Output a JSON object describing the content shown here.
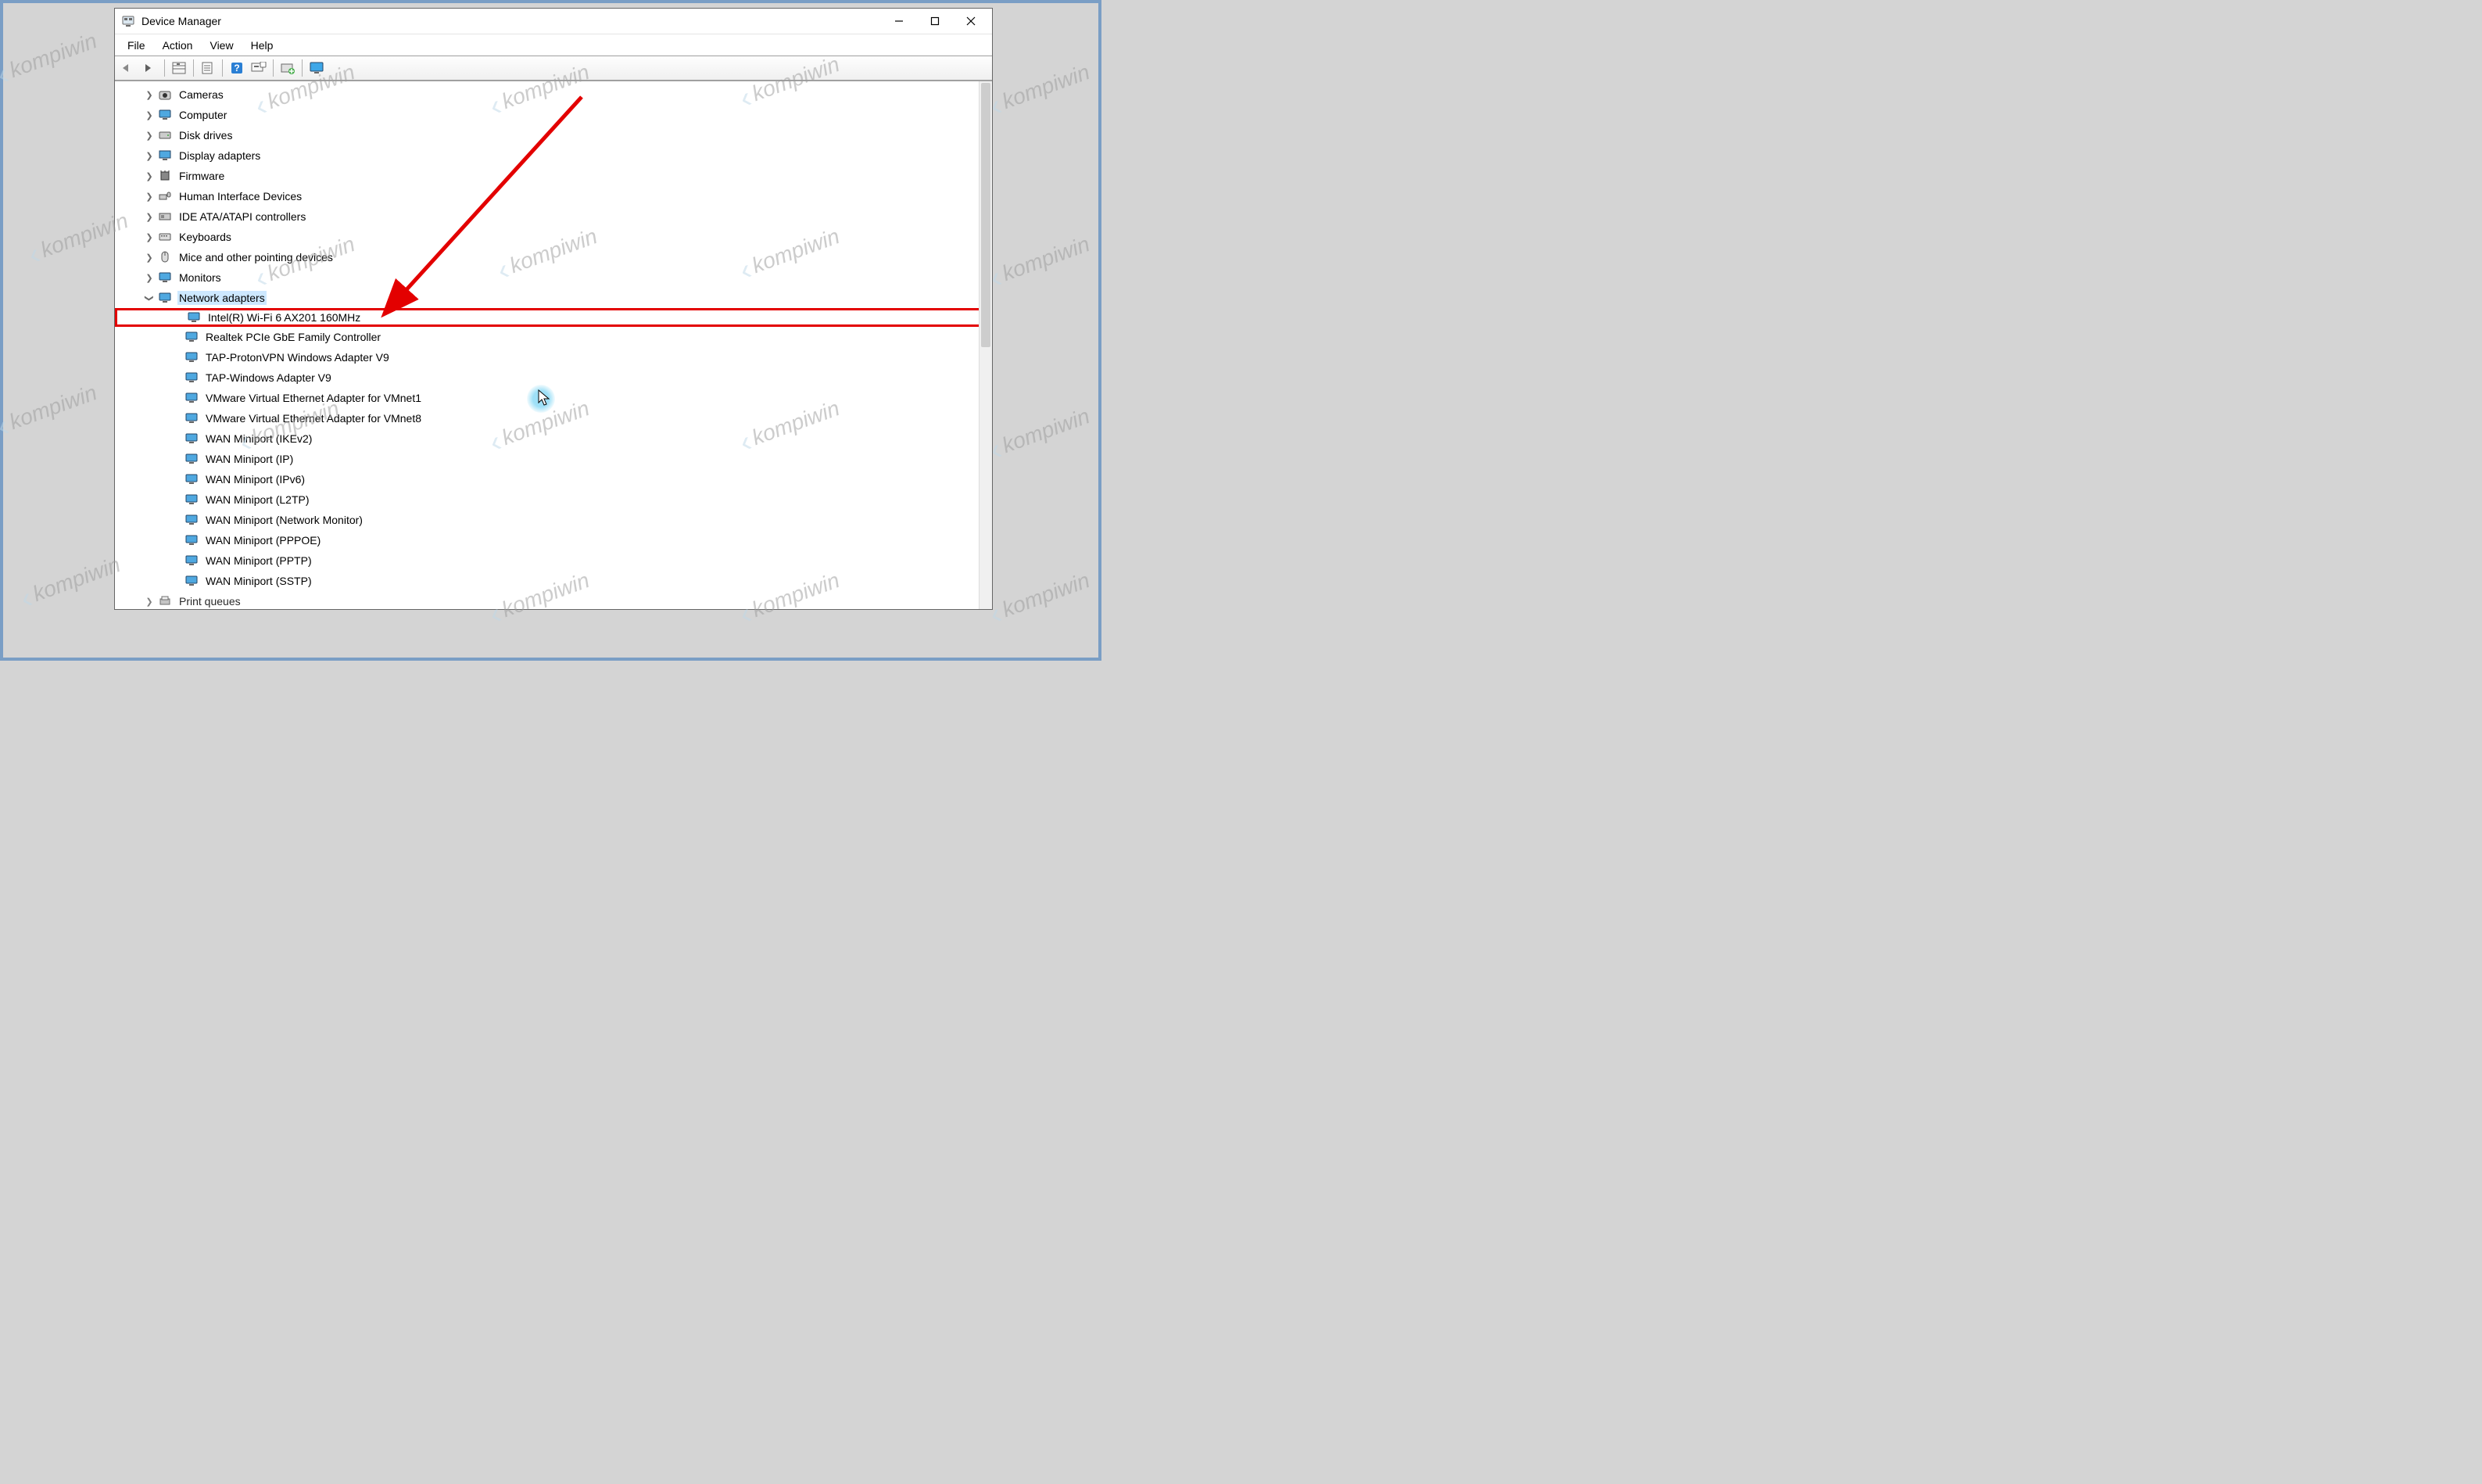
{
  "window": {
    "title": "Device Manager"
  },
  "menu": {
    "file": "File",
    "action": "Action",
    "view": "View",
    "help": "Help"
  },
  "categories": {
    "cameras": "Cameras",
    "computer": "Computer",
    "disk_drives": "Disk drives",
    "display_adapters": "Display adapters",
    "firmware": "Firmware",
    "hid": "Human Interface Devices",
    "ide": "IDE ATA/ATAPI controllers",
    "keyboards": "Keyboards",
    "mice": "Mice and other pointing devices",
    "monitors": "Monitors",
    "network_adapters": "Network adapters",
    "print_queues": "Print queues"
  },
  "network_adapters": {
    "intel_wifi": "Intel(R) Wi-Fi 6 AX201 160MHz",
    "realtek": "Realtek PCIe GbE Family Controller",
    "tap_proton": "TAP-ProtonVPN Windows Adapter V9",
    "tap_windows": "TAP-Windows Adapter V9",
    "vmware1": "VMware Virtual Ethernet Adapter for VMnet1",
    "vmware8": "VMware Virtual Ethernet Adapter for VMnet8",
    "wan_ikev2": "WAN Miniport (IKEv2)",
    "wan_ip": "WAN Miniport (IP)",
    "wan_ipv6": "WAN Miniport (IPv6)",
    "wan_l2tp": "WAN Miniport (L2TP)",
    "wan_netmon": "WAN Miniport (Network Monitor)",
    "wan_pppoe": "WAN Miniport (PPPOE)",
    "wan_pptp": "WAN Miniport (PPTP)",
    "wan_sstp": "WAN Miniport (SSTP)"
  },
  "watermark": "kompiwin",
  "annotation": {
    "highlight_target": "Intel(R) Wi-Fi 6 AX201 160MHz",
    "highlight_color": "#e30000"
  }
}
